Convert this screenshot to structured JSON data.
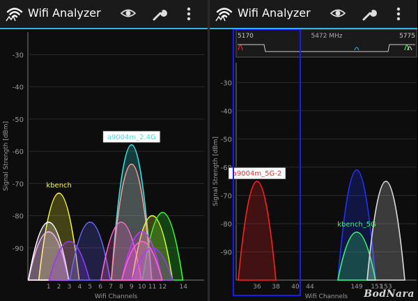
{
  "app": {
    "title": "Wifi Analyzer"
  },
  "toolbar": {
    "icons": [
      "wifi-logo-icon",
      "eye-icon",
      "wrench-icon",
      "overflow-menu-icon"
    ]
  },
  "watermark": "BodNara",
  "colors": {
    "accent": "#33b5e5",
    "background": "#0d0d0d",
    "axis": "#808080",
    "highlight_box": "#1a1aff"
  },
  "chart_data": [
    {
      "type": "line",
      "band": "2.4GHz",
      "title": "",
      "xlabel": "Wifi Channels",
      "ylabel": "Signal Strength [dBm]",
      "xlim": [
        -1,
        16
      ],
      "ylim": [
        -100,
        -23
      ],
      "yticks": [
        -30,
        -40,
        -50,
        -60,
        -70,
        -80,
        -90
      ],
      "xticks": [
        "1",
        "2",
        "3",
        "4",
        "5",
        "6",
        "7",
        "8",
        "9",
        "10",
        "11",
        "12",
        "14"
      ],
      "xtick_values": [
        1,
        2,
        3,
        4,
        5,
        6,
        7,
        8,
        9,
        10,
        11,
        12,
        14
      ],
      "series": [
        {
          "name": "kbench",
          "channel": 2,
          "dbm": -73,
          "color": "#ffff33"
        },
        {
          "name": "a9004m_2.4G",
          "channel": 9,
          "dbm": -58,
          "color": "#33e5e5",
          "boxed": true
        },
        {
          "name": "",
          "channel": 9,
          "dbm": -64,
          "color": "#ff9999"
        },
        {
          "name": "",
          "channel": 1,
          "dbm": -85,
          "color": "#ff99ff"
        },
        {
          "name": "",
          "channel": 1,
          "dbm": -82,
          "color": "#ffffff"
        },
        {
          "name": "",
          "channel": 3,
          "dbm": -88,
          "color": "#9933ff"
        },
        {
          "name": "",
          "channel": 5,
          "dbm": -82,
          "color": "#6666ff"
        },
        {
          "name": "",
          "channel": 8,
          "dbm": -82,
          "color": "#ff66cc"
        },
        {
          "name": "",
          "channel": 11,
          "dbm": -80,
          "color": "#ffff33"
        },
        {
          "name": "",
          "channel": 12,
          "dbm": -79,
          "color": "#33ff33"
        },
        {
          "name": "",
          "channel": 10,
          "dbm": -85,
          "color": "#cc33ff"
        },
        {
          "name": "",
          "channel": 11,
          "dbm": -90,
          "color": "#9933ff"
        },
        {
          "name": "",
          "channel": 10,
          "dbm": -88,
          "color": "#ff66cc"
        }
      ]
    },
    {
      "type": "line",
      "band": "5GHz",
      "title": "",
      "xlabel": "Wifi Channels",
      "ylabel": "Signal Strength [dBm]",
      "overview_labels": [
        "5170",
        "5472 MHz",
        "5775"
      ],
      "ylim": [
        -100,
        -23
      ],
      "yticks": [
        -30,
        -40,
        -50,
        -60,
        -70,
        -80,
        -90
      ],
      "xticks": [
        "36",
        "38",
        "40",
        "44",
        "149",
        "151",
        "153"
      ],
      "series": [
        {
          "name": "a9004m_5G-2",
          "channel": 36,
          "dbm": -65,
          "color": "#ff2020",
          "boxed": true
        },
        {
          "name": "",
          "channel": 149,
          "dbm": -61,
          "color": "#2233ff",
          "boxed": true
        },
        {
          "name": "kbench_5G",
          "channel": 149,
          "dbm": -83,
          "color": "#33ff66"
        },
        {
          "name": "",
          "channel": 153,
          "dbm": -65,
          "color": "#dddddd"
        }
      ]
    }
  ]
}
